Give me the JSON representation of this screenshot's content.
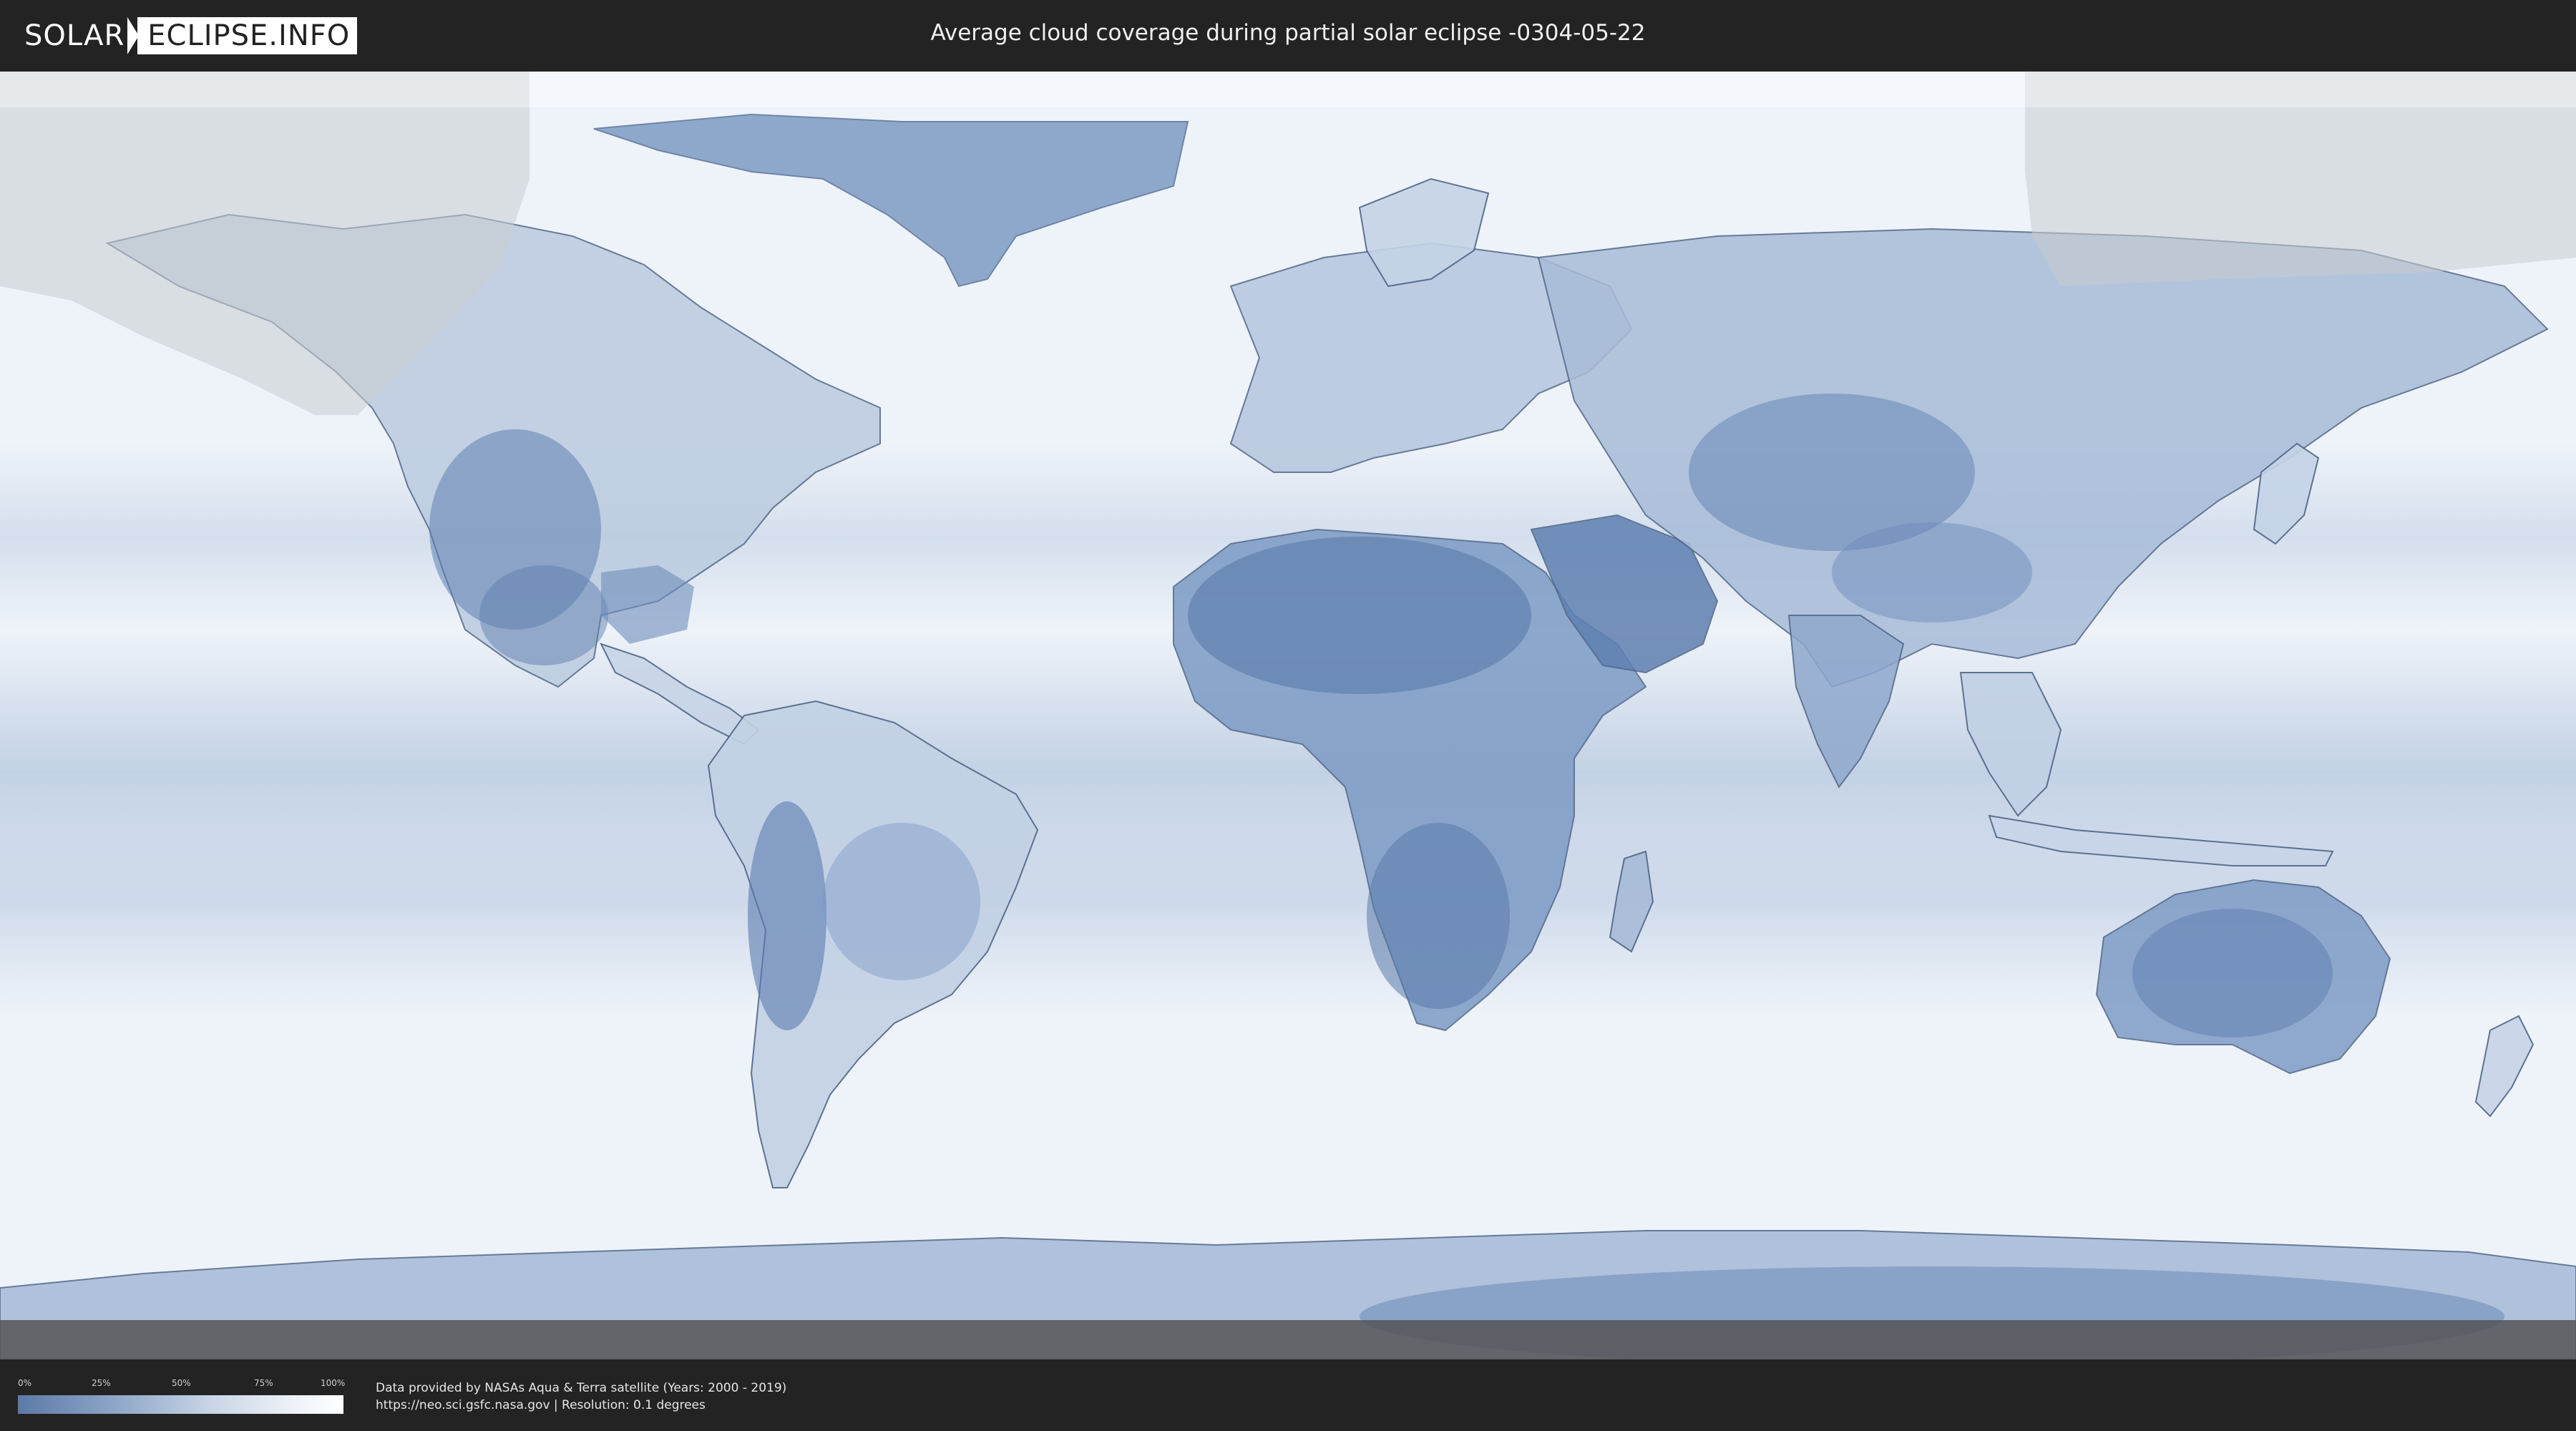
{
  "logo": {
    "left": "SOLAR",
    "right": "ECLIPSE.INFO"
  },
  "page_title": "Average cloud coverage during partial solar eclipse -0304-05-22",
  "legend": {
    "ticks": [
      "0%",
      "25%",
      "50%",
      "75%",
      "100%"
    ],
    "colors": {
      "low": "#5b7aa8",
      "high": "#ffffff"
    }
  },
  "credit": {
    "line1": "Data provided by NASAs Aqua & Terra satellite (Years: 2000 - 2019)",
    "line2": "https://neo.sci.gsfc.nasa.gov | Resolution: 0.1 degrees"
  },
  "map": {
    "ocean_color": "#f1f5fa",
    "land_clear_color": "#5e7fb0",
    "eclipse_shadow_color": "#c8ccd2"
  }
}
